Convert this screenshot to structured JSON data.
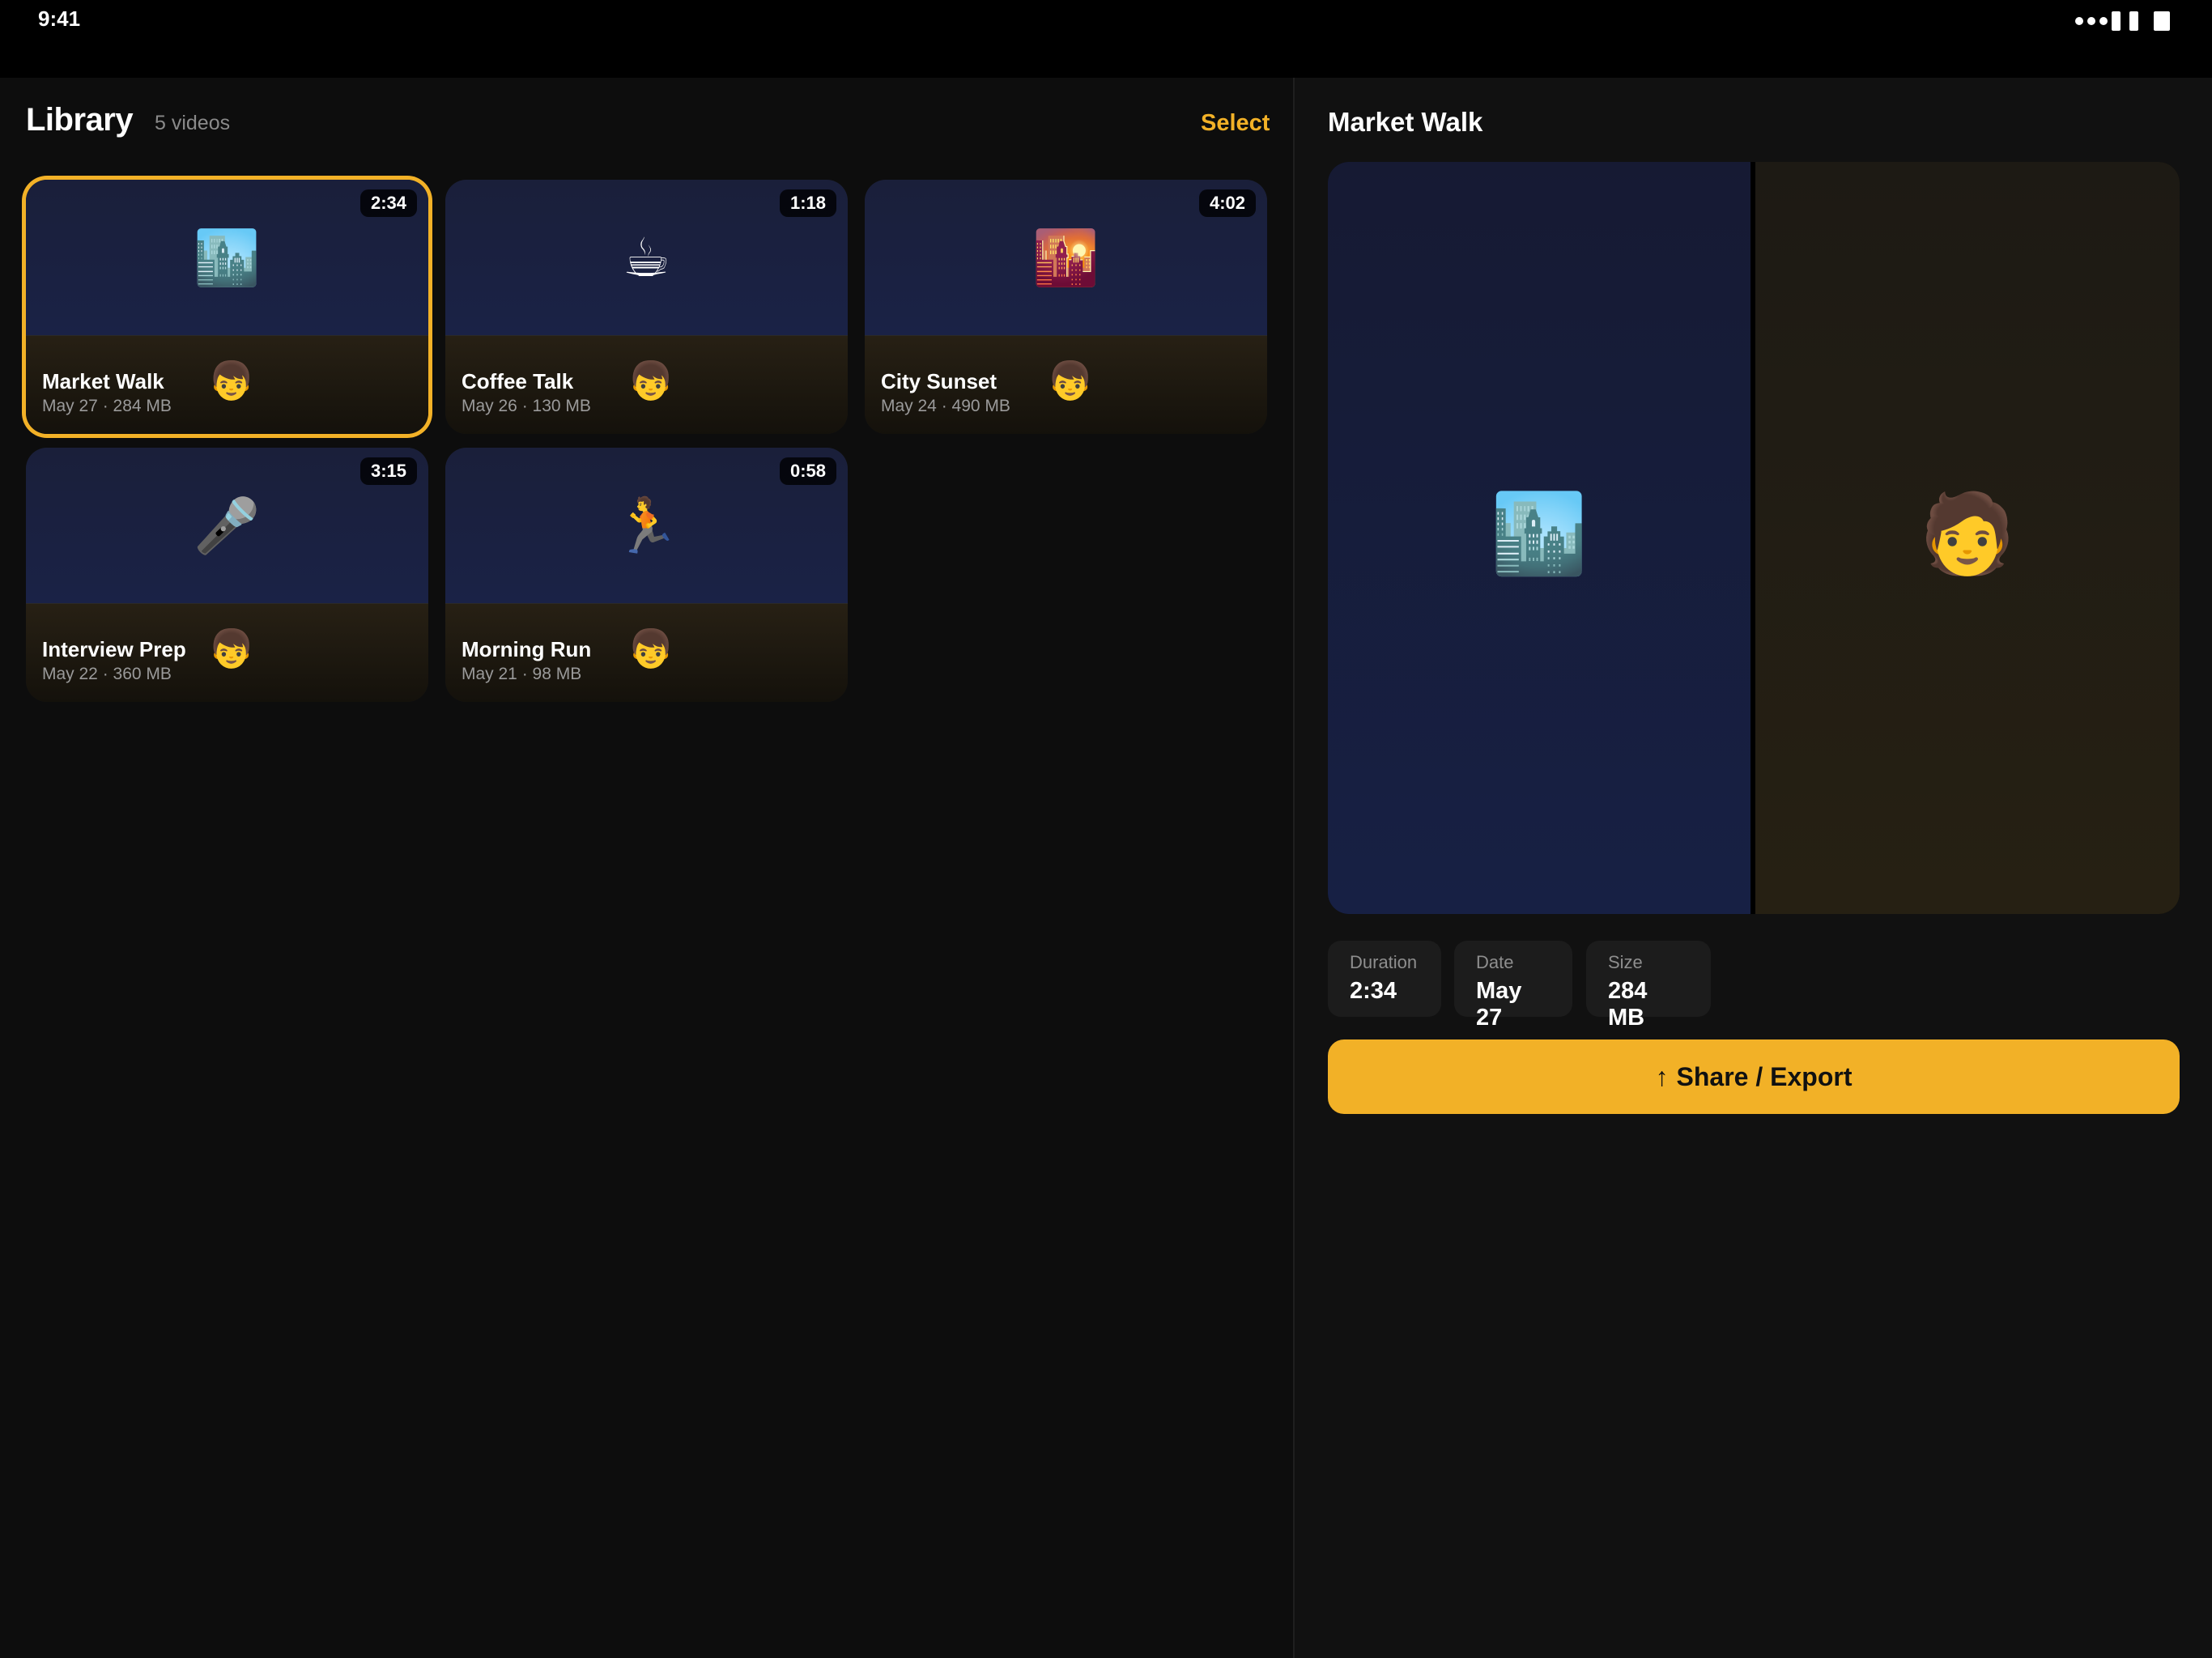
{
  "status_bar": {
    "time": "9:41"
  },
  "library": {
    "title": "Library",
    "count": "5 videos",
    "select_label": "Select",
    "videos": [
      {
        "title": "Market Walk",
        "subtitle": "May 27 · 284 MB",
        "duration": "2:34",
        "thumb": "🏙️",
        "avatar": "👦",
        "selected": true
      },
      {
        "title": "Coffee Talk",
        "subtitle": "May 26 · 130 MB",
        "duration": "1:18",
        "thumb": "☕",
        "avatar": "👦",
        "selected": false
      },
      {
        "title": "City Sunset",
        "subtitle": "May 24 · 490 MB",
        "duration": "4:02",
        "thumb": "🌇",
        "avatar": "👦",
        "selected": false
      },
      {
        "title": "Interview Prep",
        "subtitle": "May 22 · 360 MB",
        "duration": "3:15",
        "thumb": "🎤",
        "avatar": "👦",
        "selected": false
      },
      {
        "title": "Morning Run",
        "subtitle": "May 21 · 98 MB",
        "duration": "0:58",
        "thumb": "🏃",
        "avatar": "👦",
        "selected": false
      }
    ]
  },
  "preview": {
    "title": "Market Walk",
    "left_icon": "🏙️",
    "right_icon": "🧑",
    "stats": [
      {
        "label": "Duration",
        "value": "2:34"
      },
      {
        "label": "Date",
        "value": "May 27"
      },
      {
        "label": "Size",
        "value": "284 MB"
      }
    ],
    "share_icon": "↑",
    "share_label": "Share / Export"
  },
  "colors": {
    "accent": "#f2b127",
    "background": "#0d0d0d",
    "panel": "#111111"
  }
}
